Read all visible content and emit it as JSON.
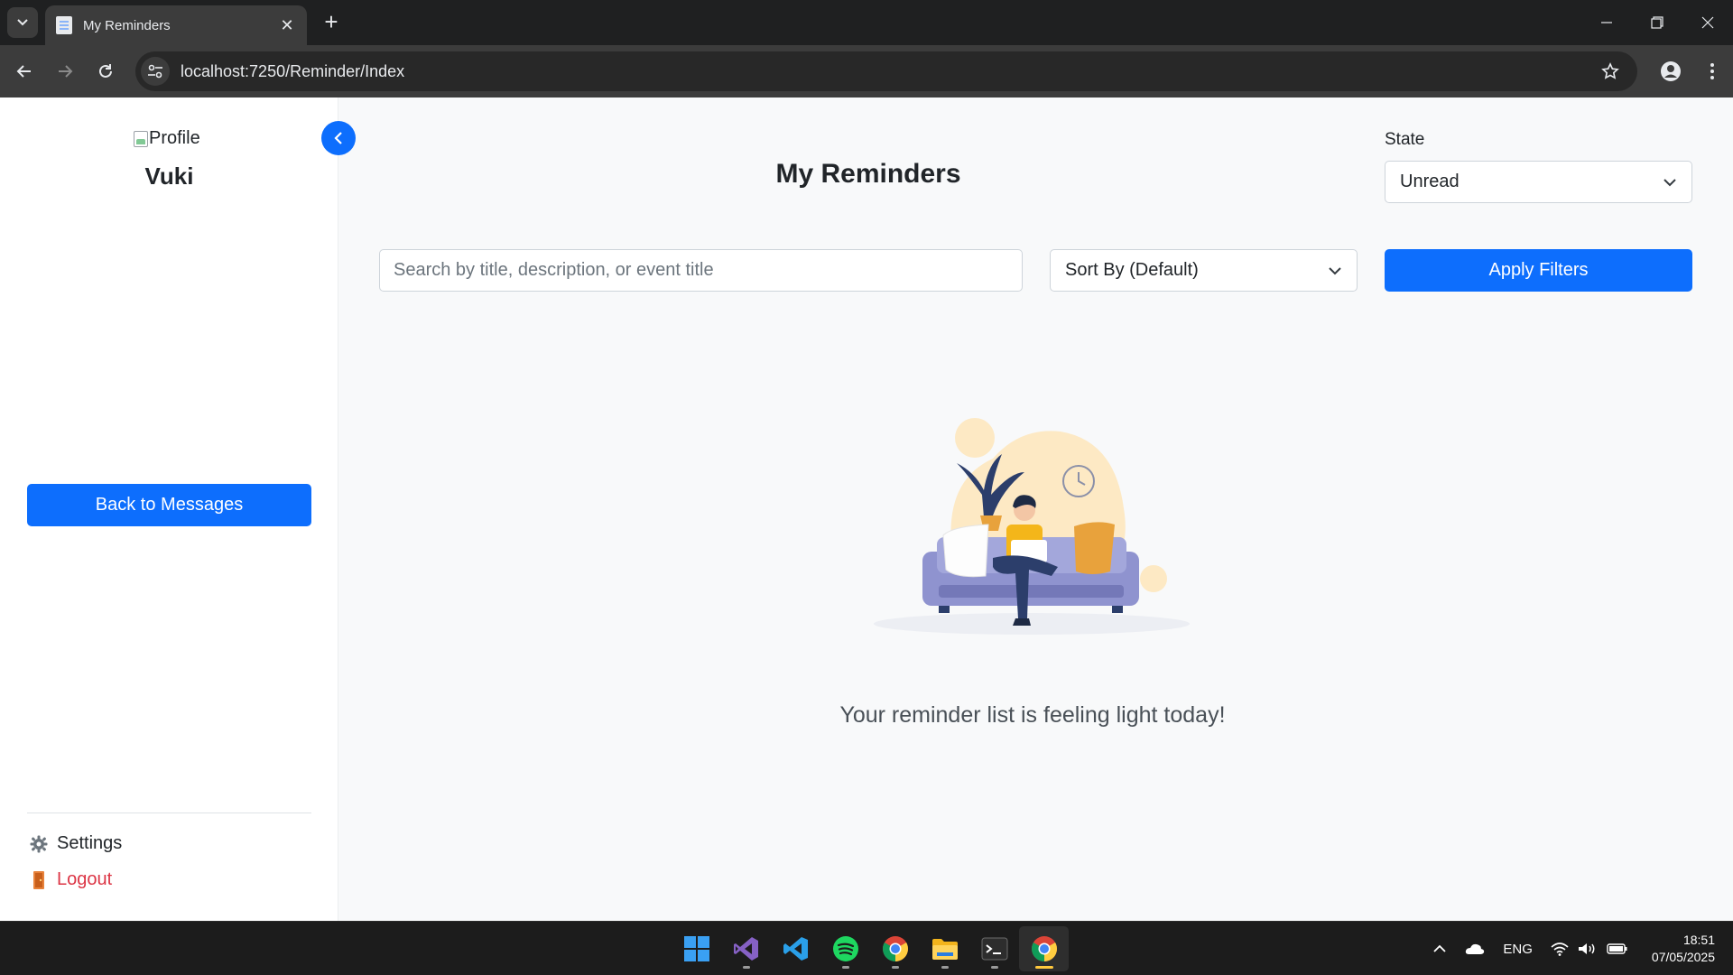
{
  "browser": {
    "tab_title": "My Reminders",
    "url": "localhost:7250/Reminder/Index"
  },
  "sidebar": {
    "profile_alt": "Profile",
    "username": "Vuki",
    "back_button": "Back to Messages",
    "settings_label": "Settings",
    "logout_label": "Logout"
  },
  "main": {
    "title": "My Reminders",
    "state_label": "State",
    "state_value": "Unread",
    "search_placeholder": "Search by title, description, or event title",
    "sort_value": "Sort By (Default)",
    "apply_button": "Apply Filters",
    "empty_message": "Your reminder list is feeling light today!"
  },
  "taskbar": {
    "apps": [
      "windows-start",
      "visual-studio",
      "vs-code",
      "spotify",
      "chrome",
      "file-explorer",
      "terminal",
      "chrome"
    ],
    "language": "ENG",
    "time": "18:51",
    "date": "07/05/2025"
  },
  "colors": {
    "primary": "#0d6efd",
    "danger": "#dc3545",
    "page_bg": "#f8f9fa"
  }
}
